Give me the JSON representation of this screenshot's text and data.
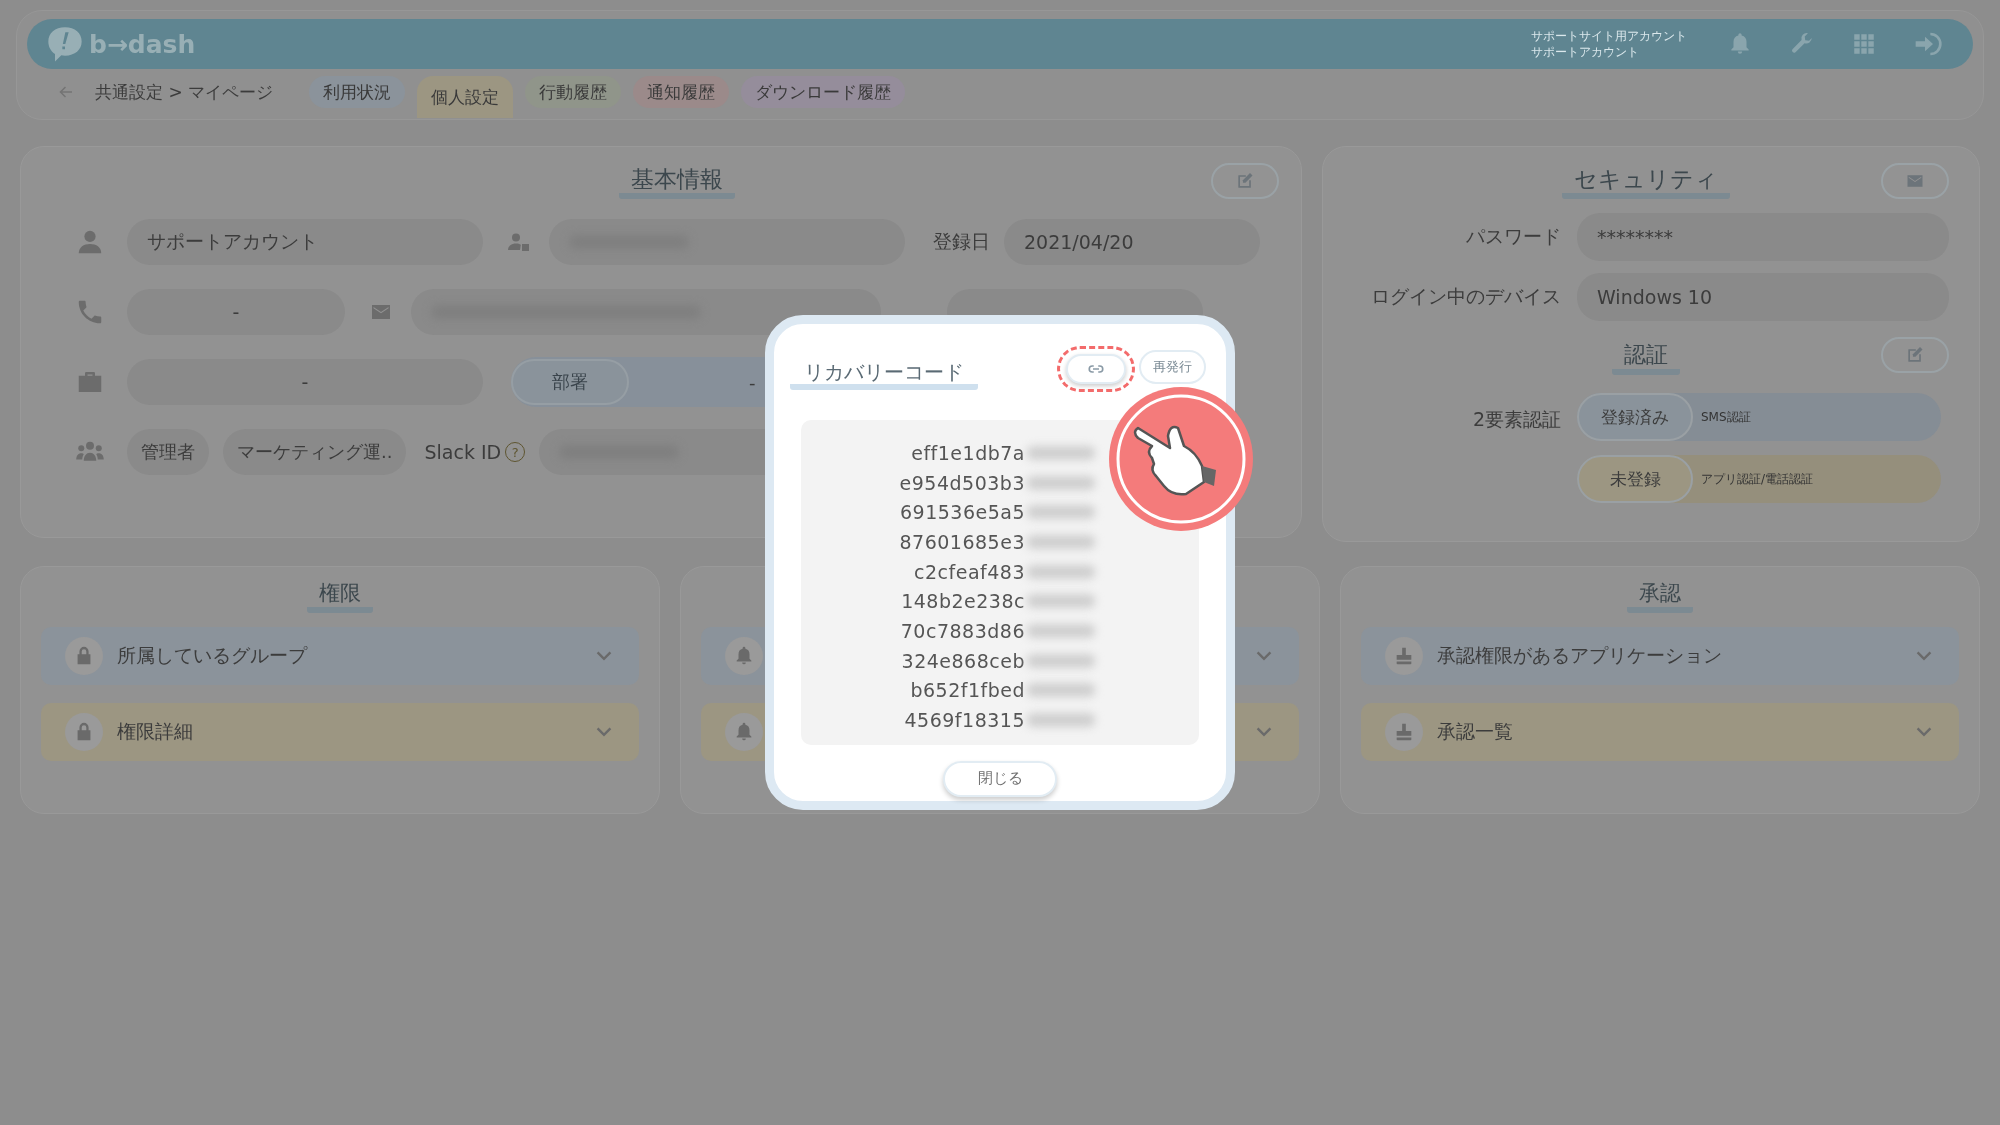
{
  "header": {
    "logo": "b→dash",
    "account": [
      "サポートサイト用アカウント",
      "サポートアカウント"
    ]
  },
  "breadcrumb": "共通設定 > マイページ",
  "tabs": [
    {
      "label": "利用状況",
      "selected": false,
      "color": "#8b939b"
    },
    {
      "label": "個人設定",
      "selected": true,
      "color": "#9c9682"
    },
    {
      "label": "行動履歴",
      "selected": false,
      "color": "#90958a"
    },
    {
      "label": "通知履歴",
      "selected": false,
      "color": "#9b8a8a"
    },
    {
      "label": "ダウンロード履歴",
      "selected": false,
      "color": "#958d9b"
    }
  ],
  "basic_info": {
    "title": "基本情報",
    "name": {
      "value": "サポートアカウント"
    },
    "registered": {
      "label": "登録日",
      "value": "2021/04/20"
    },
    "phone": {
      "value": "-"
    },
    "company": {
      "value": "-"
    },
    "department": {
      "label": "部署",
      "value": "-"
    },
    "roles": [
      "管理者",
      "マーケティング運.."
    ],
    "slack": {
      "label": "Slack ID",
      "help": "?"
    }
  },
  "security": {
    "title": "セキュリティ",
    "fields": [
      {
        "label": "パスワード",
        "value": "********"
      },
      {
        "label": "ログイン中のデバイス",
        "value": "Windows 10"
      }
    ],
    "auth_title": "認証",
    "two_factor": {
      "label": "2要素認証",
      "methods": [
        {
          "status": "登録済み",
          "method": "SMS認証",
          "registered": true
        },
        {
          "status": "未登録",
          "method": "アプリ認証/電話認証",
          "registered": false
        }
      ]
    }
  },
  "permissions": {
    "title": "権限",
    "items": [
      {
        "label": "所属しているグループ",
        "color": "#8b939b"
      },
      {
        "label": "権限詳細",
        "color": "#9c9682"
      }
    ]
  },
  "approvals": {
    "title": "承認",
    "items": [
      {
        "label": "承認権限があるアプリケーション",
        "color": "#8b939b"
      },
      {
        "label": "承認一覧",
        "color": "#9c9682"
      }
    ]
  },
  "modal": {
    "title": "リカバリーコード",
    "reissue": "再発行",
    "close": "閉じる",
    "codes": [
      "eff1e1db7a",
      "e954d503b3",
      "691536e5a5",
      "87601685e3",
      "c2cfeaf483",
      "148b2e238c",
      "70c7883d86",
      "324e868ceb",
      "b652f1fbed",
      "4569f18315"
    ]
  }
}
